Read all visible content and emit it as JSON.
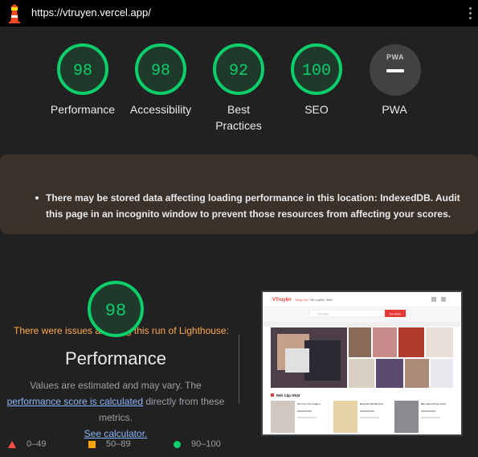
{
  "report": {
    "url": "https://vtruyen.vercel.app/"
  },
  "categories": [
    {
      "title": "Performance",
      "score": "98"
    },
    {
      "title": "Accessibility",
      "score": "98"
    },
    {
      "title": "Best Practices",
      "score": "92"
    },
    {
      "title": "SEO",
      "score": "100"
    }
  ],
  "pwa": {
    "title": "PWA",
    "badge_text": "PWA"
  },
  "warning": {
    "title": "There were issues affecting this run of Lighthouse:",
    "items": [
      "There may be stored data affecting loading performance in this location: IndexedDB. Audit this page in an incognito window to prevent those resources from affecting your scores."
    ]
  },
  "performance": {
    "score": "98",
    "title": "Performance",
    "desc_prefix": "Values are estimated and may vary. The ",
    "score_link": "performance score is calculated",
    "desc_middle": " directly from these metrics. ",
    "calc_link": "See calculator."
  },
  "legend": [
    {
      "range": "0–49",
      "shape": "triangle",
      "color": "#ff4e42"
    },
    {
      "range": "50–89",
      "shape": "square",
      "color": "#ffa400"
    },
    {
      "range": "90–100",
      "shape": "circle",
      "color": "#0cce6b"
    }
  ],
  "screenshot": {
    "site_name": "VTruyện",
    "nav": [
      "Trang Chủ",
      "Thể Loại",
      "Tìm",
      "Kiếm"
    ],
    "search_placeholder": "Tìm kiếm...",
    "search_button": "Tìm Kiếm",
    "section_title": "Mới Cập Nhật",
    "cards": [
      {
        "title": "Wo Over The Dragon..."
      },
      {
        "title": "Đang Bị Giết Bởi Anh..."
      },
      {
        "title": "Bảo Gấm Không Chính..."
      }
    ]
  },
  "colors": {
    "pass": "#0cce6b",
    "average": "#ffa400",
    "fail": "#ff4e42",
    "warning_text": "#ffa94d",
    "link": "#8ab4f8"
  }
}
